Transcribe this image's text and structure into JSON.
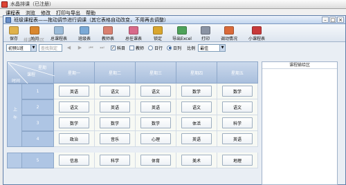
{
  "app": {
    "title": "水晶排课（已注册）",
    "menu": [
      "课程表",
      "浏览",
      "修改",
      "打印与导出",
      "帮助"
    ]
  },
  "window": {
    "title": "班级课程表——拖动调节进行调课（其它表格自动改变，不用再去调整）",
    "controls": [
      "–",
      "□",
      "×"
    ]
  },
  "toolbar": [
    {
      "label": "保存",
      "icon": "save-icon",
      "color": "#e0b24a"
    },
    {
      "label": "关闭",
      "icon": "close-icon",
      "color": "#d9872e"
    },
    {
      "label": "总课程表",
      "icon": "master-schedule-icon",
      "color": "#9bbbd8"
    },
    {
      "label": "班级表",
      "icon": "class-table-icon",
      "color": "#7aa9d6"
    },
    {
      "label": "教师表",
      "icon": "teacher-table-icon",
      "color": "#d98070"
    },
    {
      "label": "总任课表",
      "icon": "teaching-table-icon",
      "color": "#d86a8a"
    },
    {
      "label": "锁定",
      "icon": "lock-icon",
      "color": "#d9a62e"
    },
    {
      "label": "导出Excel",
      "icon": "excel-icon",
      "color": "#4ea25a"
    },
    {
      "label": "打印",
      "icon": "print-icon",
      "color": "#8a93a3"
    },
    {
      "label": "调动情况",
      "icon": "adjust-icon",
      "color": "#d96a3a"
    },
    {
      "label": "小课程表",
      "icon": "small-schedule-icon",
      "color": "#c83a3a"
    }
  ],
  "options": {
    "class_value": "初预1班",
    "search_placeholder": "查找指定",
    "checks": [
      {
        "label": "科目",
        "checked": true
      },
      {
        "label": "教师",
        "checked": false
      }
    ],
    "radios": [
      {
        "label": "日行",
        "selected": false
      },
      {
        "label": "日列",
        "selected": true
      }
    ],
    "scale_label": "比例",
    "scale_value": "最佳"
  },
  "grid": {
    "caption": "排课调节区",
    "corner": {
      "top": "星期",
      "middle": "课程",
      "bottom": "时间"
    },
    "days": [
      "星期一",
      "星期二",
      "星期三",
      "星期四",
      "星期五"
    ],
    "sections": [
      {
        "label": "上午",
        "rows": [
          {
            "period": "1",
            "subjects": [
              "英语",
              "语文",
              "语文",
              "数学",
              "数学"
            ]
          },
          {
            "period": "2",
            "subjects": [
              "语文",
              "英语",
              "英语",
              "语文",
              "语文"
            ]
          },
          {
            "period": "3",
            "subjects": [
              "数学",
              "数学",
              "数学",
              "体活",
              "科学"
            ]
          },
          {
            "period": "4",
            "subjects": [
              "政治",
              "音乐",
              "心理",
              "英语",
              "英语"
            ]
          }
        ]
      },
      {
        "label": "",
        "rows": [
          {
            "period": "5",
            "subjects": [
              "信息",
              "科学",
              "体育",
              "美术",
              "地理"
            ]
          }
        ]
      }
    ]
  },
  "pool": {
    "title": "课程输给区"
  },
  "watermark": {
    "main": "Baidu经验",
    "sub": "jingyan.baidu.com"
  }
}
